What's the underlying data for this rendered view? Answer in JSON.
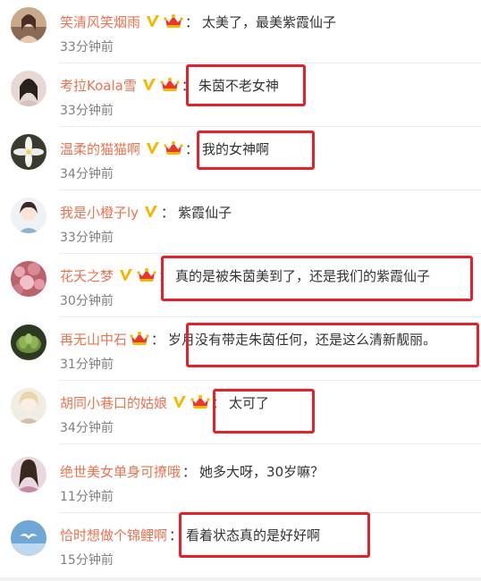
{
  "colors": {
    "username": "#eb7350",
    "comment_text": "#333333",
    "time_text": "#808080",
    "highlight_box": "#e5202a",
    "verified_badge": "#f5b800"
  },
  "comments": [
    {
      "username": "笑清风笑烟雨",
      "text": "太美了，最美紫霞仙子",
      "time": "33分钟前",
      "crown": true,
      "avatar_icon": "woman-portrait-avatar",
      "highlighted": false
    },
    {
      "username": "考拉Koala雪",
      "text": "朱茵不老女神",
      "time": "33分钟前",
      "crown": true,
      "avatar_icon": "girl-portrait-avatar",
      "highlighted": true
    },
    {
      "username": "温柔的猫猫啊",
      "text": "我的女神啊",
      "time": "34分钟前",
      "crown": true,
      "avatar_icon": "white-flower-avatar",
      "highlighted": true
    },
    {
      "username": "我是小橙子ly",
      "text": "紫霞仙子",
      "time": "33分钟前",
      "crown": false,
      "avatar_icon": "cartoon-girl-avatar",
      "highlighted": false
    },
    {
      "username": "花夭之梦",
      "text": "真的是被朱茵美到了，还是我们的紫霞仙子",
      "time": "30分钟前",
      "crown": true,
      "avatar_icon": "pink-flowers-avatar",
      "highlighted": true
    },
    {
      "username": "再无山中石",
      "text": "岁月没有带走朱茵任何，还是这么清新靓丽。",
      "time": "31分钟前",
      "crown": true,
      "avatar_icon": "succulent-plant-avatar",
      "highlighted": true
    },
    {
      "username": "胡同小巷口的姑娘",
      "text": "太可了",
      "time": "34分钟前",
      "crown": true,
      "avatar_icon": "anime-character-avatar",
      "highlighted": true
    },
    {
      "username": "绝世美女单身可撩哦",
      "text": "她多大呀，30岁嘛？",
      "time": "11分钟前",
      "crown": false,
      "avatar_icon": "woman-photo-avatar",
      "highlighted": false
    },
    {
      "username": "恰时想做个锦鲤啊",
      "text": "看着状态真的是好好啊",
      "time": "15分钟前",
      "crown": false,
      "avatar_icon": "sky-bird-avatar",
      "highlighted": true
    }
  ]
}
